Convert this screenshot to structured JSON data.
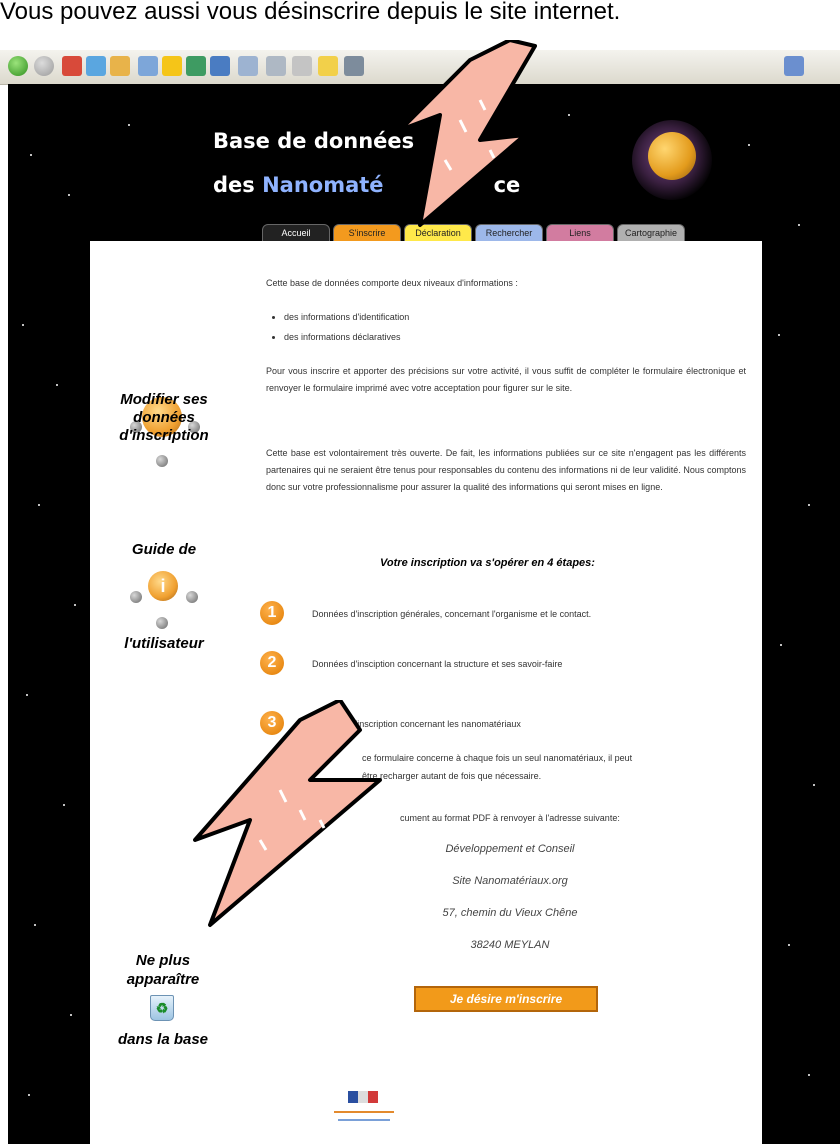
{
  "caption": "Vous pouvez aussi vous désinscrire depuis le site internet.",
  "site": {
    "title_line1": "Base de données",
    "title_line2_prefix": "des ",
    "title_line2_blue": "Nanomaté",
    "title_line2_suffix": "ce",
    "tabs": [
      {
        "label": "Accueil",
        "color": "#222222",
        "text": "#ffffff"
      },
      {
        "label": "S'inscrire",
        "color": "#f39a1e",
        "text": "#222222"
      },
      {
        "label": "Déclaration",
        "color": "#ffe94a",
        "text": "#222222"
      },
      {
        "label": "Rechercher",
        "color": "#9db8ea",
        "text": "#222222"
      },
      {
        "label": "Liens",
        "color": "#d27ca0",
        "text": "#222222"
      },
      {
        "label": "Cartographie",
        "color": "#b0b0b0",
        "text": "#222222"
      }
    ],
    "sidebar": {
      "modify": [
        "Modifier ses",
        "données",
        "d'inscription"
      ],
      "guide_top": "Guide de",
      "guide_bottom": "l'utilisateur",
      "unsubscribe": [
        "Ne plus",
        "apparaître",
        "dans la base"
      ]
    },
    "content": {
      "intro": "Cette base de données comporte deux niveaux d'informations :",
      "bullets": [
        "des informations d'identification",
        "des informations déclaratives"
      ],
      "para1": "Pour vous inscrire et apporter des précisions sur votre activité, il vous suffit de compléter le formulaire électronique et renvoyer le formulaire imprimé avec votre acceptation pour figurer sur le site.",
      "para2": "Cette base est volontairement très ouverte. De fait, les informations publiées sur ce site n'engagent pas les différents partenaires qui ne seraient être tenus pour responsables du contenu des informations ni de leur validité. Nous comptons donc sur votre professionnalisme pour assurer la qualité des informations qui seront mises en ligne.",
      "steps_heading": "Votre inscription va s'opérer en 4 étapes:",
      "steps": [
        {
          "num": "1",
          "text": "Données d'inscription générales, concernant l'organisme et le contact."
        },
        {
          "num": "2",
          "text": "Données d'insciption concernant la structure et ses savoir-faire"
        },
        {
          "num": "3",
          "text": "Données d'inscription concernant les nanomatériaux"
        }
      ],
      "step3_note_line1": "ce formulaire concerne à chaque fois un seul nanomatériaux, il peut",
      "step3_note_line2": "être recharger autant de fois que nécessaire.",
      "pdf_line": "cument au format PDF à renvoyer à l'adresse suivante:",
      "address": [
        "Développement et Conseil",
        "Site Nanomatériaux.org",
        "57, chemin du Vieux Chêne",
        "38240 MEYLAN"
      ],
      "cta": "Je désire m'inscrire"
    }
  }
}
